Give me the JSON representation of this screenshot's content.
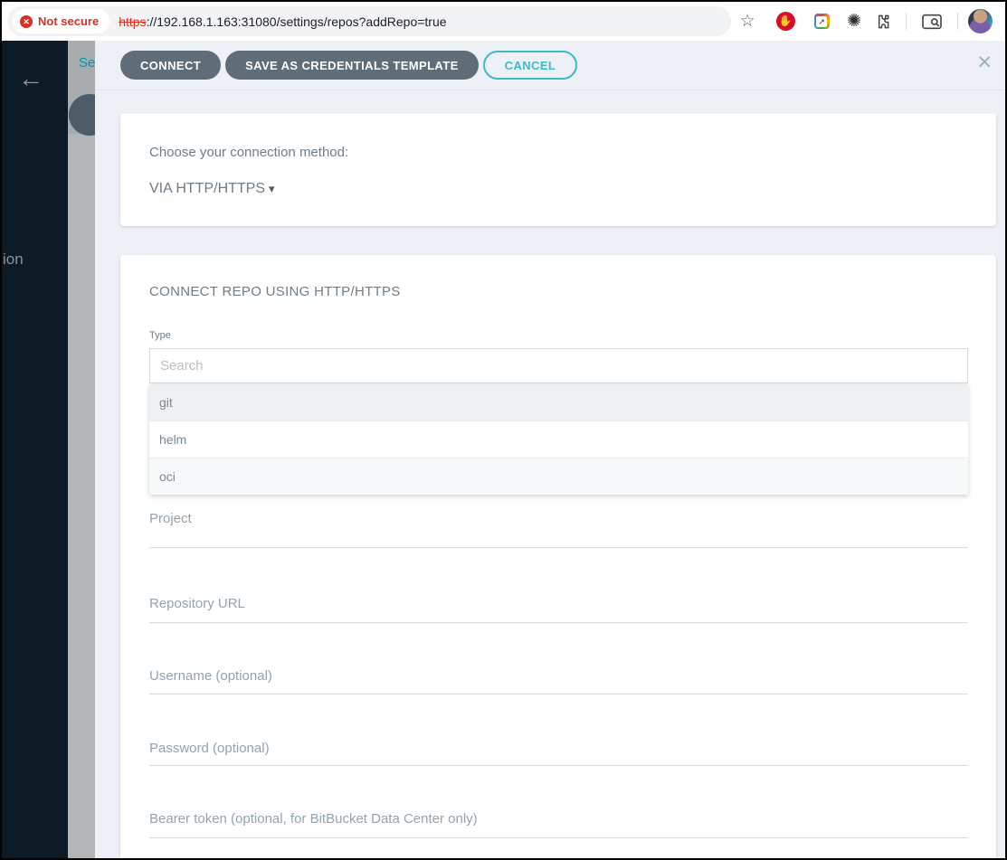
{
  "browser": {
    "not_secure_label": "Not secure",
    "not_secure_glyph": "✕",
    "url_scheme": "https",
    "url_rest": "://192.168.1.163:31080/settings/repos?addRepo=true",
    "star_glyph": "☆",
    "adblock_glyph": "✋",
    "gear_glyph": "✺"
  },
  "underlying_page": {
    "breadcrumb_clipped": "Se",
    "sidebar_clipped_label": "ion",
    "back_glyph": "←"
  },
  "modal": {
    "toolbar": {
      "connect_label": "CONNECT",
      "save_template_label": "SAVE AS CREDENTIALS TEMPLATE",
      "cancel_label": "CANCEL",
      "close_glyph": "✕"
    },
    "method_card": {
      "prompt": "Choose your connection method:",
      "selected_method": "VIA HTTP/HTTPS",
      "caret_glyph": "▾"
    },
    "form_card": {
      "title": "CONNECT REPO USING HTTP/HTTPS",
      "type_label": "Type",
      "search_placeholder": "Search",
      "type_options": {
        "0": "git",
        "1": "helm",
        "2": "oci"
      },
      "fields": {
        "0": "Project",
        "1": "Repository URL",
        "2": "Username (optional)",
        "3": "Password (optional)",
        "4": "Bearer token (optional, for BitBucket Data Center only)"
      }
    }
  },
  "colors": {
    "accent_teal": "#3db9c9",
    "button_slate": "#5f6d78",
    "danger_red": "#d93025",
    "sidebar_navy": "#0d1b26",
    "modal_bg": "#edf1f5"
  }
}
